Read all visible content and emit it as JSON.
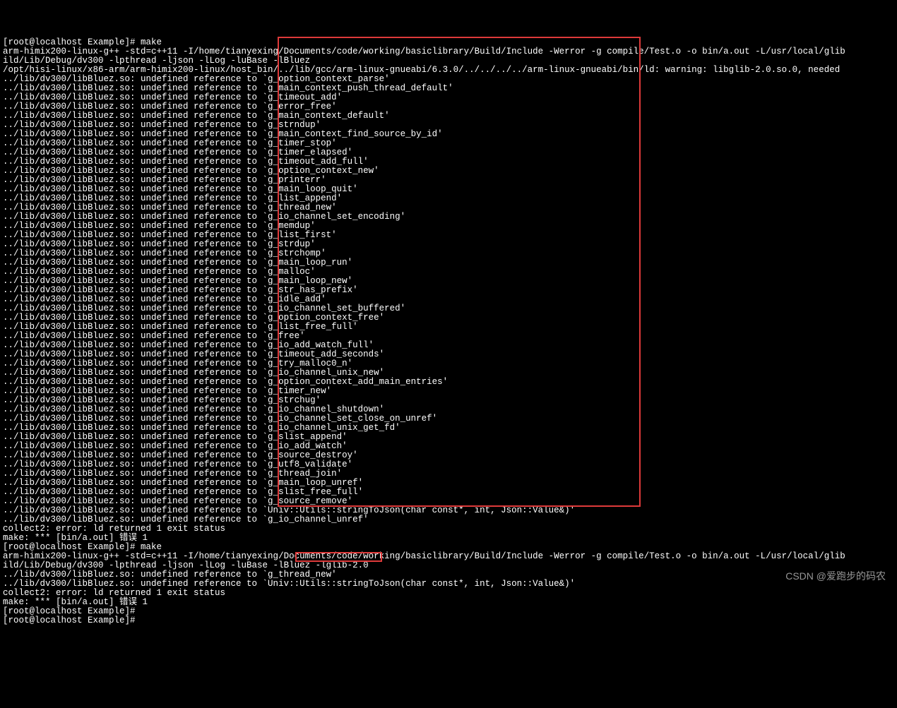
{
  "prompt1": "[root@localhost Example]# make",
  "compile1": "arm-himix200-linux-g++ -std=c++11 -I/home/tianyexing/Documents/code/working/basiclibrary/Build/Include -Werror -g compile/Test.o -o bin/a.out -L/usr/local/glib",
  "compile2": "ild/Lib/Debug/dv300 -lpthread -ljson -lLog -luBase -lBluez",
  "ldwarn": "/opt/hisi-linux/x86-arm/arm-himix200-linux/host_bin/../lib/gcc/arm-linux-gnueabi/6.3.0/../../../../arm-linux-gnueabi/bin/ld: warning: libglib-2.0.so.0, needed",
  "errPrefix": "../lib/dv300/libBluez.so: undefined reference to `",
  "symbols": [
    "g_option_context_parse'",
    "g_main_context_push_thread_default'",
    "g_timeout_add'",
    "g_error_free'",
    "g_main_context_default'",
    "g_strndup'",
    "g_main_context_find_source_by_id'",
    "g_timer_stop'",
    "g_timer_elapsed'",
    "g_timeout_add_full'",
    "g_option_context_new'",
    "g_printerr'",
    "g_main_loop_quit'",
    "g_list_append'",
    "g_thread_new'",
    "g_io_channel_set_encoding'",
    "g_memdup'",
    "g_list_first'",
    "g_strdup'",
    "g_strchomp'",
    "g_main_loop_run'",
    "g_malloc'",
    "g_main_loop_new'",
    "g_str_has_prefix'",
    "g_idle_add'",
    "g_io_channel_set_buffered'",
    "g_option_context_free'",
    "g_list_free_full'",
    "g_free'",
    "g_io_add_watch_full'",
    "g_timeout_add_seconds'",
    "g_try_malloc0_n'",
    "g_io_channel_unix_new'",
    "g_option_context_add_main_entries'",
    "g_timer_new'",
    "g_strchug'",
    "g_io_channel_shutdown'",
    "g_io_channel_set_close_on_unref'",
    "g_io_channel_unix_get_fd'",
    "g_slist_append'",
    "g_io_add_watch'",
    "g_source_destroy'",
    "g_utf8_validate'",
    "g_thread_join'",
    "g_main_loop_unref'",
    "g_slist_free_full'",
    "g_source_remove'",
    "Univ::Utils::stringToJson(char const*, int, Json::Value&)'",
    "g_io_channel_unref'"
  ],
  "collect2": "collect2: error: ld returned 1 exit status",
  "makeErr": "make: *** [bin/a.out] 错误 1",
  "prompt2": "[root@localhost Example]# make",
  "compile3": "arm-himix200-linux-g++ -std=c++11 -I/home/tianyexing/Documents/code/working/basiclibrary/Build/Include -Werror -g compile/Test.o -o bin/a.out -L/usr/local/glib",
  "compile4": "ild/Lib/Debug/dv300 -lpthread -ljson -lLog -luBase -lBluez -lglib-2.0",
  "err2a": "../lib/dv300/libBluez.so: undefined reference to `g_thread_new'",
  "err2b": "../lib/dv300/libBluez.so: undefined reference to `Univ::Utils::stringToJson(char const*, int, Json::Value&)'",
  "prompt3": "[root@localhost Example]#",
  "prompt4": "[root@localhost Example]#",
  "watermark": "CSDN @爱跑步的码农"
}
